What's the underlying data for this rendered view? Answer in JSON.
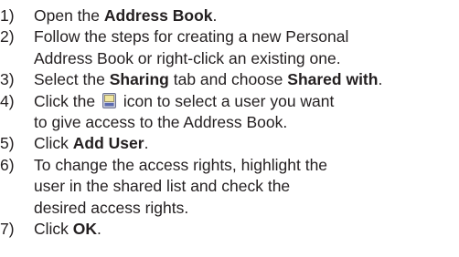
{
  "steps": [
    {
      "number": "1)",
      "lines": [
        [
          {
            "t": "Open the "
          },
          {
            "t": "Address Book",
            "bold": true
          },
          {
            "t": "."
          }
        ]
      ]
    },
    {
      "number": "2)",
      "lines": [
        [
          {
            "t": "Follow the steps for creating a new Personal"
          }
        ],
        [
          {
            "t": "Address Book or right-click an existing one."
          }
        ]
      ]
    },
    {
      "number": "3)",
      "lines": [
        [
          {
            "t": "Select the "
          },
          {
            "t": "Sharing",
            "bold": true
          },
          {
            "t": " tab and choose "
          },
          {
            "t": "Shared with",
            "bold": true
          },
          {
            "t": "."
          }
        ]
      ]
    },
    {
      "number": "4)",
      "lines": [
        [
          {
            "t": "Click the "
          },
          {
            "icon": "address-book-icon"
          },
          {
            "t": " icon to select a user you want"
          }
        ],
        [
          {
            "t": "to give access to the Address Book."
          }
        ]
      ]
    },
    {
      "number": "5)",
      "lines": [
        [
          {
            "t": "Click "
          },
          {
            "t": "Add User",
            "bold": true
          },
          {
            "t": "."
          }
        ]
      ]
    },
    {
      "number": "6)",
      "lines": [
        [
          {
            "t": "To change the access rights, highlight the"
          }
        ],
        [
          {
            "t": "user in the shared list and check the"
          }
        ],
        [
          {
            "t": "desired access rights."
          }
        ]
      ]
    },
    {
      "number": "7)",
      "lines": [
        [
          {
            "t": "Click "
          },
          {
            "t": "OK",
            "bold": true
          },
          {
            "t": "."
          }
        ]
      ]
    }
  ]
}
